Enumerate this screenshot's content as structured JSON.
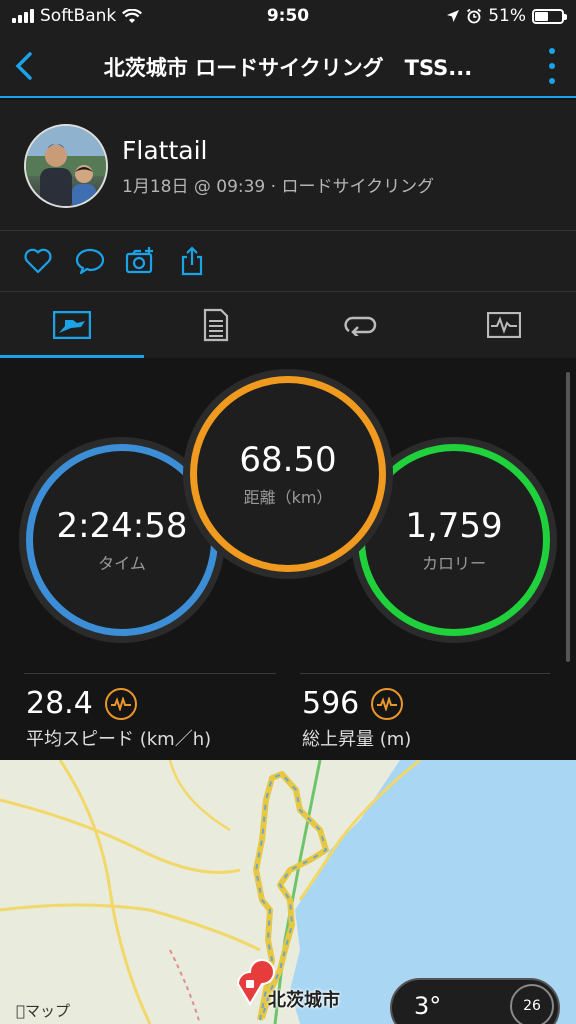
{
  "status_bar": {
    "carrier": "SoftBank",
    "time": "9:50",
    "battery": "51%",
    "battery_fraction": 0.51
  },
  "nav": {
    "title": "北茨城市 ロードサイクリング　TSS..."
  },
  "activity": {
    "user_name": "Flattail",
    "subtitle": "1月18日 @ 09:39 · ロードサイクリング"
  },
  "stats": {
    "time": {
      "value": "2:24:58",
      "label": "タイム",
      "color": "#3c8fd6"
    },
    "distance": {
      "value": "68.50",
      "label": "距離（km）",
      "color": "#f09a1f"
    },
    "calories": {
      "value": "1,759",
      "label": "カロリー",
      "color": "#1fd13a"
    },
    "avg_speed": {
      "value": "28.4",
      "label": "平均スピード (km／h)"
    },
    "elevation": {
      "value": "596",
      "label": "総上昇量 (m)"
    }
  },
  "map": {
    "city_label": "北茨城市",
    "attribution": "マップ",
    "temperature": "3°",
    "wind": "26"
  },
  "colors": {
    "accent": "#1aa3e8",
    "badge": "#e9962a",
    "sea": "#a9d7f3",
    "route": "#e7c844"
  }
}
